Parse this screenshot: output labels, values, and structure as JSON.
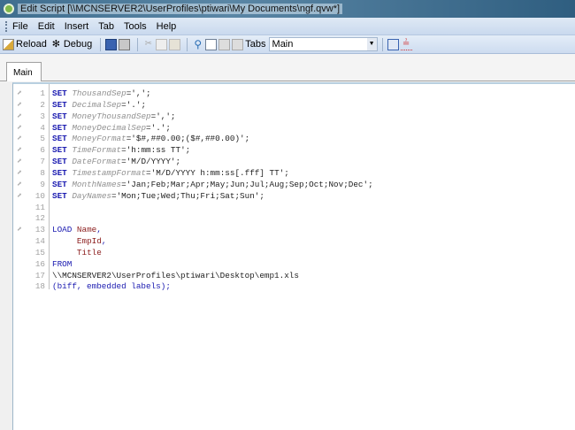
{
  "window": {
    "title": "Edit Script [\\\\MCNSERVER2\\UserProfiles\\ptiwari\\My Documents\\ngf.qvw*]"
  },
  "menu": [
    "File",
    "Edit",
    "Insert",
    "Tab",
    "Tools",
    "Help"
  ],
  "toolbar": {
    "reload": "Reload",
    "debug": "Debug",
    "tabs_label": "Tabs",
    "tabs_value": "Main"
  },
  "tabs": [
    {
      "label": "Main",
      "active": true
    }
  ],
  "colors": {
    "keyword": "#1a1ab0",
    "variable": "#909090",
    "field": "#8b1c1c"
  },
  "script": [
    {
      "n": "1",
      "wrench": true,
      "tokens": [
        [
          "kw",
          "SET"
        ],
        [
          "plain",
          " "
        ],
        [
          "var",
          "ThousandSep"
        ],
        [
          "str",
          "=',';"
        ]
      ]
    },
    {
      "n": "2",
      "wrench": true,
      "tokens": [
        [
          "kw",
          "SET"
        ],
        [
          "plain",
          " "
        ],
        [
          "var",
          "DecimalSep"
        ],
        [
          "str",
          "='.';"
        ]
      ]
    },
    {
      "n": "3",
      "wrench": true,
      "tokens": [
        [
          "kw",
          "SET"
        ],
        [
          "plain",
          " "
        ],
        [
          "var",
          "MoneyThousandSep"
        ],
        [
          "str",
          "=',';"
        ]
      ]
    },
    {
      "n": "4",
      "wrench": true,
      "tokens": [
        [
          "kw",
          "SET"
        ],
        [
          "plain",
          " "
        ],
        [
          "var",
          "MoneyDecimalSep"
        ],
        [
          "str",
          "='.';"
        ]
      ]
    },
    {
      "n": "5",
      "wrench": true,
      "tokens": [
        [
          "kw",
          "SET"
        ],
        [
          "plain",
          " "
        ],
        [
          "var",
          "MoneyFormat"
        ],
        [
          "str",
          "='$#,##0.00;($#,##0.00)';"
        ]
      ]
    },
    {
      "n": "6",
      "wrench": true,
      "tokens": [
        [
          "kw",
          "SET"
        ],
        [
          "plain",
          " "
        ],
        [
          "var",
          "TimeFormat"
        ],
        [
          "str",
          "='h:mm:ss TT';"
        ]
      ]
    },
    {
      "n": "7",
      "wrench": true,
      "tokens": [
        [
          "kw",
          "SET"
        ],
        [
          "plain",
          " "
        ],
        [
          "var",
          "DateFormat"
        ],
        [
          "str",
          "='M/D/YYYY';"
        ]
      ]
    },
    {
      "n": "8",
      "wrench": true,
      "tokens": [
        [
          "kw",
          "SET"
        ],
        [
          "plain",
          " "
        ],
        [
          "var",
          "TimestampFormat"
        ],
        [
          "str",
          "='M/D/YYYY h:mm:ss[.fff] TT';"
        ]
      ]
    },
    {
      "n": "9",
      "wrench": true,
      "tokens": [
        [
          "kw",
          "SET"
        ],
        [
          "plain",
          " "
        ],
        [
          "var",
          "MonthNames"
        ],
        [
          "str",
          "='Jan;Feb;Mar;Apr;May;Jun;Jul;Aug;Sep;Oct;Nov;Dec';"
        ]
      ]
    },
    {
      "n": "10",
      "wrench": true,
      "tokens": [
        [
          "kw",
          "SET"
        ],
        [
          "plain",
          " "
        ],
        [
          "var",
          "DayNames"
        ],
        [
          "str",
          "='Mon;Tue;Wed;Thu;Fri;Sat;Sun';"
        ]
      ]
    },
    {
      "n": "11",
      "wrench": false,
      "tokens": []
    },
    {
      "n": "12",
      "wrench": false,
      "tokens": []
    },
    {
      "n": "13",
      "wrench": true,
      "tokens": [
        [
          "plain",
          "LOAD "
        ],
        [
          "fld",
          "Name"
        ],
        [
          "plain",
          ","
        ]
      ]
    },
    {
      "n": "14",
      "wrench": false,
      "tokens": [
        [
          "plain",
          "     "
        ],
        [
          "fld",
          "EmpId"
        ],
        [
          "plain",
          ","
        ]
      ]
    },
    {
      "n": "15",
      "wrench": false,
      "tokens": [
        [
          "plain",
          "     "
        ],
        [
          "fld",
          "Title"
        ]
      ]
    },
    {
      "n": "16",
      "wrench": false,
      "tokens": [
        [
          "plain",
          "FROM"
        ]
      ]
    },
    {
      "n": "17",
      "wrench": false,
      "tokens": [
        [
          "path",
          "\\\\MCNSERVER2\\UserProfiles\\ptiwari\\Desktop\\emp1.xls"
        ]
      ]
    },
    {
      "n": "18",
      "wrench": false,
      "tokens": [
        [
          "plain",
          "(biff, embedded labels);"
        ]
      ]
    }
  ]
}
